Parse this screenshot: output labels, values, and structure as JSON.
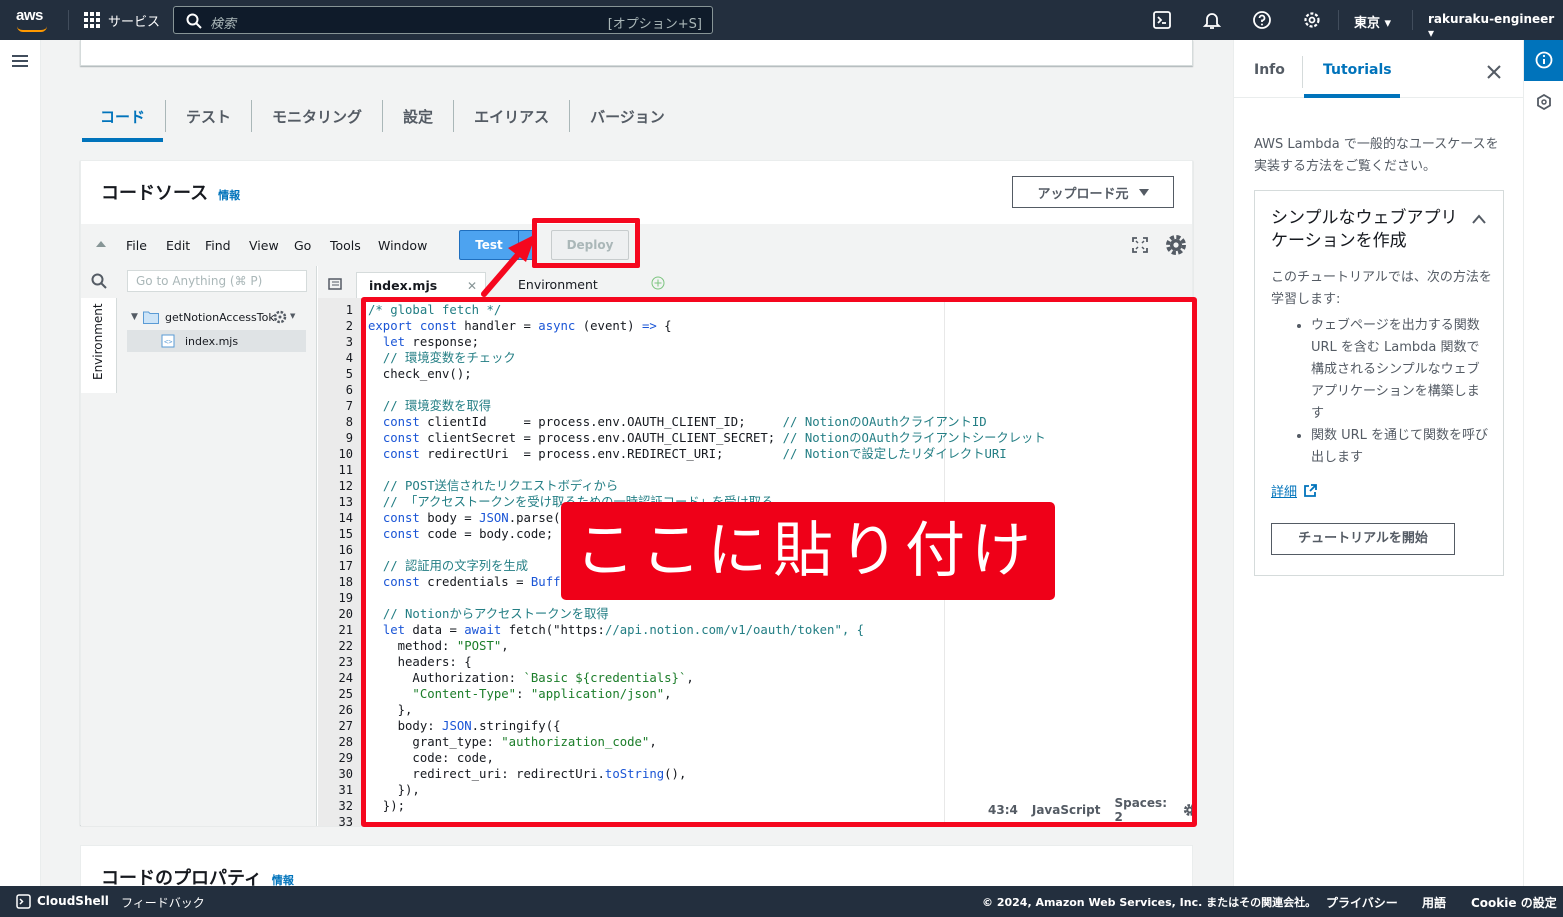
{
  "nav": {
    "logo": "aws",
    "services": "サービス",
    "search_placeholder": "検索",
    "search_shortcut": "[オプション+S]",
    "region": "東京",
    "account": "rakuraku-engineer"
  },
  "tabs": [
    "コード",
    "テスト",
    "モニタリング",
    "設定",
    "エイリアス",
    "バージョン"
  ],
  "code_source": {
    "title": "コードソース",
    "info": "情報",
    "upload": "アップロード元"
  },
  "ide": {
    "menu": [
      "File",
      "Edit",
      "Find",
      "View",
      "Go",
      "Tools",
      "Window"
    ],
    "test": "Test",
    "deploy": "Deploy",
    "goto_placeholder": "Go to Anything (⌘ P)",
    "env_tab": "Environment",
    "tree_folder": "getNotionAccessTok",
    "tree_file": "index.mjs",
    "editor_tabs": [
      "index.mjs",
      "Environment Vari"
    ],
    "status": {
      "position": "43:4",
      "language": "JavaScript",
      "spaces": "Spaces: 2"
    }
  },
  "code_lines": [
    "/* global fetch */",
    "export const handler = async (event) => {",
    "  let response;",
    "  // 環境変数をチェック",
    "  check_env();",
    "",
    "  // 環境変数を取得",
    "  const clientId     = process.env.OAUTH_CLIENT_ID;     // NotionのOAuthクライアントID",
    "  const clientSecret = process.env.OAUTH_CLIENT_SECRET; // NotionのOAuthクライアントシークレット",
    "  const redirectUri  = process.env.REDIRECT_URI;        // Notionで設定したリダイレクトURI",
    "",
    "  // POST送信されたリクエストボディから",
    "  // 「アクセストークンを受け取るための一時認証コード」を受け取る",
    "  const body = JSON.parse(event.body);",
    "  const code = body.code;",
    "",
    "  // 認証用の文字列を生成",
    "  const credentials = Buffer.from(`${clientId}:${clientSecret}`).toString(\"base64\");",
    "",
    "  // Notionからアクセストークンを取得",
    "  let data = await fetch(\"https://api.notion.com/v1/oauth/token\", {",
    "    method: \"POST\",",
    "    headers: {",
    "      Authorization: `Basic ${credentials}`,",
    "      \"Content-Type\": \"application/json\",",
    "    },",
    "    body: JSON.stringify({",
    "      grant_type: \"authorization_code\",",
    "      code: code,",
    "      redirect_uri: redirectUri.toString(),",
    "    }),",
    "  });",
    ""
  ],
  "annotation": {
    "paste_here": "ここに貼り付け"
  },
  "code_properties": {
    "title": "コードのプロパティ",
    "info": "情報"
  },
  "help": {
    "tab_info": "Info",
    "tab_tutorials": "Tutorials",
    "intro": "AWS Lambda で一般的なユースケースを実装する方法をご覧ください。",
    "card_title": "シンプルなウェブアプリケーションを作成",
    "card_desc": "このチュートリアルでは、次の方法を学習します:",
    "bullets": [
      "ウェブページを出力する関数 URL を含む Lambda 関数で構成されるシンプルなウェブアプリケーションを構築します",
      "関数 URL を通じて関数を呼び出します"
    ],
    "more": "詳細",
    "start": "チュートリアルを開始"
  },
  "footer": {
    "cloudshell": "CloudShell",
    "feedback": "フィードバック",
    "copyright": "© 2024, Amazon Web Services, Inc. またはその関連会社。",
    "privacy": "プライバシー",
    "terms": "用語",
    "cookies": "Cookie の設定"
  },
  "colors": {
    "nav_bg": "#232f3e",
    "accent": "#0073bb",
    "annotation_red": "#f5071e"
  }
}
